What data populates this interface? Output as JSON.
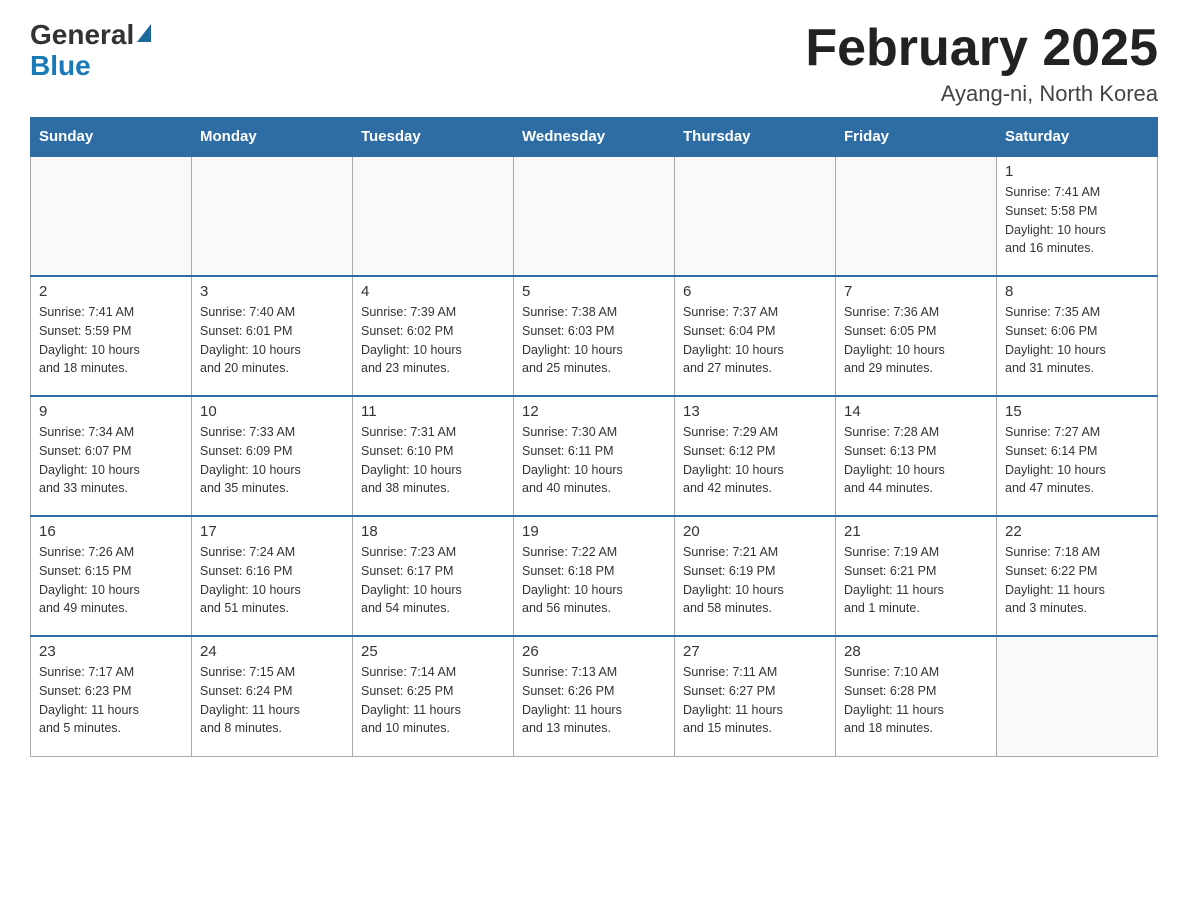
{
  "header": {
    "logo_general": "General",
    "logo_blue": "Blue",
    "title": "February 2025",
    "subtitle": "Ayang-ni, North Korea"
  },
  "weekdays": [
    "Sunday",
    "Monday",
    "Tuesday",
    "Wednesday",
    "Thursday",
    "Friday",
    "Saturday"
  ],
  "weeks": [
    [
      {
        "day": "",
        "info": ""
      },
      {
        "day": "",
        "info": ""
      },
      {
        "day": "",
        "info": ""
      },
      {
        "day": "",
        "info": ""
      },
      {
        "day": "",
        "info": ""
      },
      {
        "day": "",
        "info": ""
      },
      {
        "day": "1",
        "info": "Sunrise: 7:41 AM\nSunset: 5:58 PM\nDaylight: 10 hours\nand 16 minutes."
      }
    ],
    [
      {
        "day": "2",
        "info": "Sunrise: 7:41 AM\nSunset: 5:59 PM\nDaylight: 10 hours\nand 18 minutes."
      },
      {
        "day": "3",
        "info": "Sunrise: 7:40 AM\nSunset: 6:01 PM\nDaylight: 10 hours\nand 20 minutes."
      },
      {
        "day": "4",
        "info": "Sunrise: 7:39 AM\nSunset: 6:02 PM\nDaylight: 10 hours\nand 23 minutes."
      },
      {
        "day": "5",
        "info": "Sunrise: 7:38 AM\nSunset: 6:03 PM\nDaylight: 10 hours\nand 25 minutes."
      },
      {
        "day": "6",
        "info": "Sunrise: 7:37 AM\nSunset: 6:04 PM\nDaylight: 10 hours\nand 27 minutes."
      },
      {
        "day": "7",
        "info": "Sunrise: 7:36 AM\nSunset: 6:05 PM\nDaylight: 10 hours\nand 29 minutes."
      },
      {
        "day": "8",
        "info": "Sunrise: 7:35 AM\nSunset: 6:06 PM\nDaylight: 10 hours\nand 31 minutes."
      }
    ],
    [
      {
        "day": "9",
        "info": "Sunrise: 7:34 AM\nSunset: 6:07 PM\nDaylight: 10 hours\nand 33 minutes."
      },
      {
        "day": "10",
        "info": "Sunrise: 7:33 AM\nSunset: 6:09 PM\nDaylight: 10 hours\nand 35 minutes."
      },
      {
        "day": "11",
        "info": "Sunrise: 7:31 AM\nSunset: 6:10 PM\nDaylight: 10 hours\nand 38 minutes."
      },
      {
        "day": "12",
        "info": "Sunrise: 7:30 AM\nSunset: 6:11 PM\nDaylight: 10 hours\nand 40 minutes."
      },
      {
        "day": "13",
        "info": "Sunrise: 7:29 AM\nSunset: 6:12 PM\nDaylight: 10 hours\nand 42 minutes."
      },
      {
        "day": "14",
        "info": "Sunrise: 7:28 AM\nSunset: 6:13 PM\nDaylight: 10 hours\nand 44 minutes."
      },
      {
        "day": "15",
        "info": "Sunrise: 7:27 AM\nSunset: 6:14 PM\nDaylight: 10 hours\nand 47 minutes."
      }
    ],
    [
      {
        "day": "16",
        "info": "Sunrise: 7:26 AM\nSunset: 6:15 PM\nDaylight: 10 hours\nand 49 minutes."
      },
      {
        "day": "17",
        "info": "Sunrise: 7:24 AM\nSunset: 6:16 PM\nDaylight: 10 hours\nand 51 minutes."
      },
      {
        "day": "18",
        "info": "Sunrise: 7:23 AM\nSunset: 6:17 PM\nDaylight: 10 hours\nand 54 minutes."
      },
      {
        "day": "19",
        "info": "Sunrise: 7:22 AM\nSunset: 6:18 PM\nDaylight: 10 hours\nand 56 minutes."
      },
      {
        "day": "20",
        "info": "Sunrise: 7:21 AM\nSunset: 6:19 PM\nDaylight: 10 hours\nand 58 minutes."
      },
      {
        "day": "21",
        "info": "Sunrise: 7:19 AM\nSunset: 6:21 PM\nDaylight: 11 hours\nand 1 minute."
      },
      {
        "day": "22",
        "info": "Sunrise: 7:18 AM\nSunset: 6:22 PM\nDaylight: 11 hours\nand 3 minutes."
      }
    ],
    [
      {
        "day": "23",
        "info": "Sunrise: 7:17 AM\nSunset: 6:23 PM\nDaylight: 11 hours\nand 5 minutes."
      },
      {
        "day": "24",
        "info": "Sunrise: 7:15 AM\nSunset: 6:24 PM\nDaylight: 11 hours\nand 8 minutes."
      },
      {
        "day": "25",
        "info": "Sunrise: 7:14 AM\nSunset: 6:25 PM\nDaylight: 11 hours\nand 10 minutes."
      },
      {
        "day": "26",
        "info": "Sunrise: 7:13 AM\nSunset: 6:26 PM\nDaylight: 11 hours\nand 13 minutes."
      },
      {
        "day": "27",
        "info": "Sunrise: 7:11 AM\nSunset: 6:27 PM\nDaylight: 11 hours\nand 15 minutes."
      },
      {
        "day": "28",
        "info": "Sunrise: 7:10 AM\nSunset: 6:28 PM\nDaylight: 11 hours\nand 18 minutes."
      },
      {
        "day": "",
        "info": ""
      }
    ]
  ]
}
